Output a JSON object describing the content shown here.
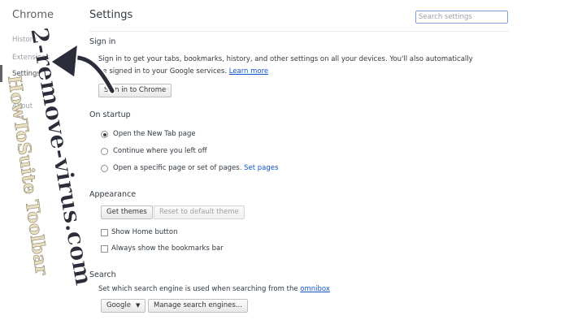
{
  "sidebar": {
    "title": "Chrome",
    "items": [
      {
        "label": "History"
      },
      {
        "label": "Extensions"
      },
      {
        "label": "Settings"
      },
      {
        "label": "About"
      }
    ]
  },
  "header": {
    "title": "Settings",
    "search_placeholder": "Search settings"
  },
  "sign_in": {
    "title": "Sign in",
    "line1": "Sign in to get your tabs, bookmarks, history, and other settings on all your devices. You'll also automatically",
    "line2": "be signed in to your Google services.",
    "learn_more": "Learn more",
    "button": "Sign in to Chrome"
  },
  "on_startup": {
    "title": "On startup",
    "options": [
      {
        "label": "Open the New Tab page",
        "selected": true
      },
      {
        "label": "Continue where you left off",
        "selected": false
      },
      {
        "label": "Open a specific page or set of pages.",
        "selected": false
      }
    ],
    "set_pages": "Set pages"
  },
  "appearance": {
    "title": "Appearance",
    "get_themes": "Get themes",
    "reset_theme": "Reset to default theme",
    "show_home": "Show Home button",
    "show_bookmarks": "Always show the bookmarks bar"
  },
  "search": {
    "title": "Search",
    "description": "Set which search engine is used when searching from the",
    "omnibox": "omnibox",
    "engine": "Google",
    "manage": "Manage search engines..."
  },
  "watermarks": {
    "site": "2-remove-virus.com",
    "toolbar": "HowToSuite Toolbar"
  },
  "colors": {
    "link": "#1155cc",
    "watermark_dark": "#2b2d3a",
    "watermark_light": "#e9e0c4"
  }
}
